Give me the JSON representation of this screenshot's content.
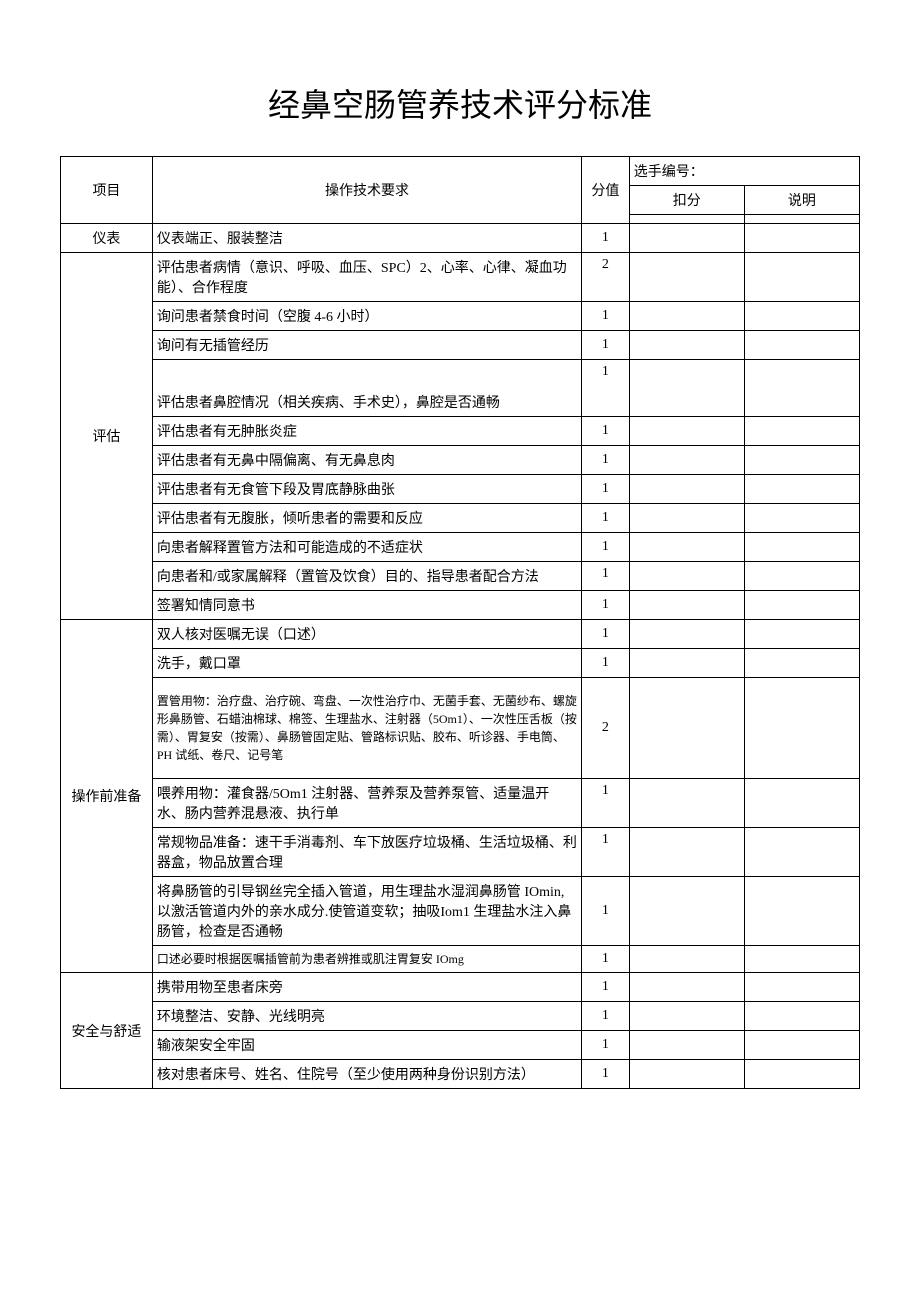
{
  "title": "经鼻空肠管养技术评分标准",
  "header": {
    "col_project": "项目",
    "col_requirement": "操作技术要求",
    "col_score": "分值",
    "contestant_label": "选手编号：",
    "col_deduct": "扣分",
    "col_note": "说明"
  },
  "sections": [
    {
      "category": "仪表",
      "rows": [
        {
          "text": "仪表端正、服装整洁",
          "score": "1"
        }
      ]
    },
    {
      "category": "评估",
      "rows": [
        {
          "text": "评估患者病情（意识、呼吸、血压、SPC）2、心率、心律、凝血功能）、合作程度",
          "score": "2"
        },
        {
          "text": "询问患者禁食时间（空腹 4-6 小时）",
          "score": "1"
        },
        {
          "text": "询问有无插管经历",
          "score": "1"
        },
        {
          "text": "评估患者鼻腔情况（相关疾病、手术史），鼻腔是否通畅",
          "score": "1"
        },
        {
          "text": "评估患者有无肿胀炎症",
          "score": "1"
        },
        {
          "text": "评估患者有无鼻中隔偏离、有无鼻息肉",
          "score": "1"
        },
        {
          "text": "评估患者有无食管下段及胃底静脉曲张",
          "score": "1"
        },
        {
          "text": "评估患者有无腹胀，倾听患者的需要和反应",
          "score": "1"
        },
        {
          "text": "向患者解释置管方法和可能造成的不适症状",
          "score": "1"
        },
        {
          "text": "向患者和/或家属解释（置管及饮食）目的、指导患者配合方法",
          "score": "1"
        },
        {
          "text": "签署知情同意书",
          "score": "1"
        }
      ]
    },
    {
      "category": "操作前准备",
      "rows": [
        {
          "text": "双人核对医嘱无误（口述）",
          "score": "1"
        },
        {
          "text": "洗手，戴口罩",
          "score": "1"
        },
        {
          "text": "置管用物：治疗盘、治疗碗、弯盘、一次性治疗巾、无菌手套、无菌纱布、螺旋形鼻肠管、石蜡油棉球、棉签、生理盐水、注射器（5Om1）、一次性压舌板（按需）、胃复安（按需）、鼻肠管固定贴、管路标识贴、胶布、听诊器、手电筒、PH 试纸、卷尺、记号笔",
          "score": "2",
          "small": true
        },
        {
          "text": "喂养用物：灌食器/5Om1 注射器、营养泵及营养泵管、适量温开水、肠内营养混悬液、执行单",
          "score": "1"
        },
        {
          "text": "常规物品准备：速干手消毒剂、车下放医疗垃圾桶、生活垃圾桶、利器盒，物品放置合理",
          "score": "1"
        },
        {
          "text": "将鼻肠管的引导钢丝完全插入管道，用生理盐水湿润鼻肠管 IOmin,以激活管道内外的亲水成分.使管道变软；抽吸Iom1 生理盐水注入鼻肠管，检查是否通畅",
          "score": "1"
        },
        {
          "text": "口述必要时根据医嘱插管前为患者辨推或肌注胃复安 IOmg",
          "score": "1",
          "small": true
        }
      ]
    },
    {
      "category": "安全与舒适",
      "rows": [
        {
          "text": "携带用物至患者床旁",
          "score": "1"
        },
        {
          "text": "环境整洁、安静、光线明亮",
          "score": "1"
        },
        {
          "text": "输液架安全牢固",
          "score": "1"
        },
        {
          "text": "核对患者床号、姓名、住院号（至少使用两种身份识别方法）",
          "score": "1"
        }
      ]
    }
  ]
}
